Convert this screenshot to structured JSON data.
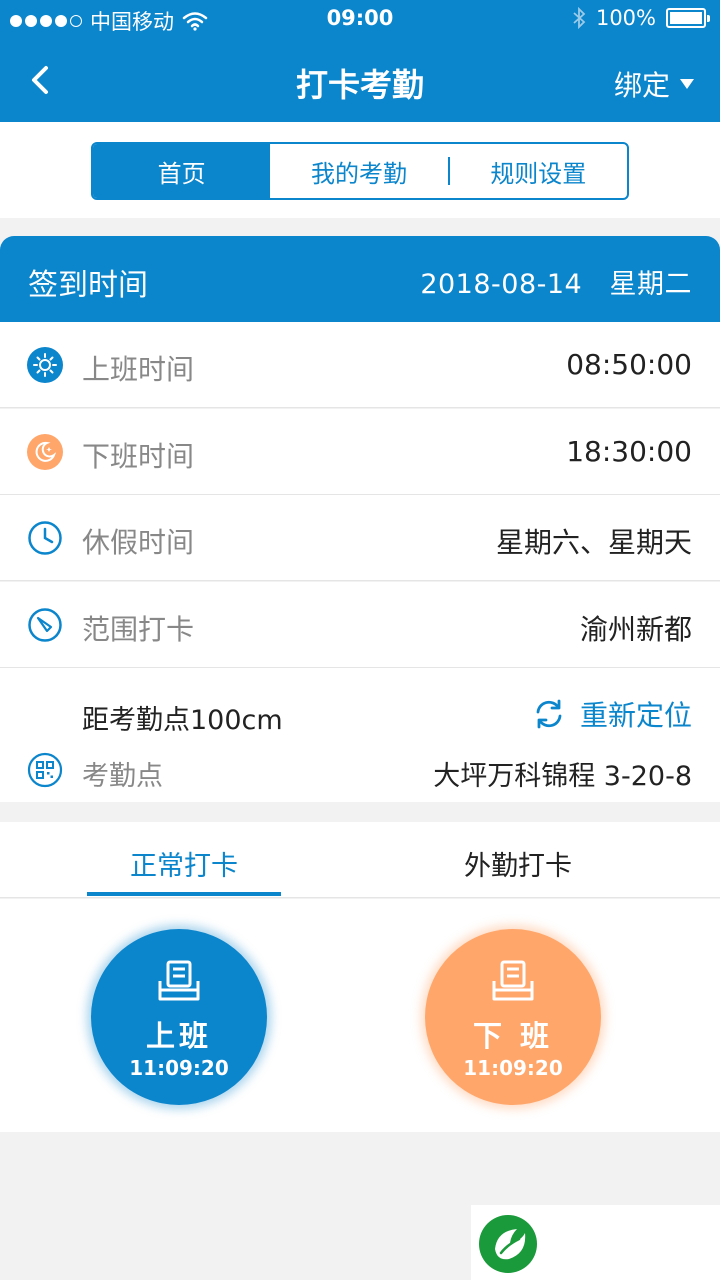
{
  "status_bar": {
    "carrier": "中国移动",
    "time": "09:00",
    "battery": "100%"
  },
  "nav": {
    "title": "打卡考勤",
    "bind_label": "绑定"
  },
  "segments": [
    {
      "label": "首页",
      "active": true
    },
    {
      "label": "我的考勤",
      "active": false
    },
    {
      "label": "规则设置",
      "active": false
    }
  ],
  "checkin": {
    "title": "签到时间",
    "date": "2018-08-14",
    "weekday": "星期二"
  },
  "rows": [
    {
      "icon": "sun-icon",
      "label": "上班时间",
      "value": "08:50:00"
    },
    {
      "icon": "moon-icon",
      "label": "下班时间",
      "value": "18:30:00"
    },
    {
      "icon": "clock-icon",
      "label": "休假时间",
      "value": "星期六、星期天"
    },
    {
      "icon": "compass-icon",
      "label": "范围打卡",
      "value": "渝州新都"
    }
  ],
  "location": {
    "distance": "距考勤点100cm",
    "relocate_label": "重新定位",
    "point_label": "考勤点",
    "point_value": "大坪万科锦程 3-20-8"
  },
  "tabs": [
    {
      "label": "正常打卡",
      "active": true
    },
    {
      "label": "外勤打卡",
      "active": false
    }
  ],
  "punch": {
    "on_duty_label": "上班",
    "on_duty_time": "11:09:20",
    "off_duty_label": "下 班",
    "off_duty_time": "11:09:20"
  },
  "colors": {
    "primary": "#0b85cc",
    "accent_orange": "#ffa66b",
    "logo_green": "#1a9a3a"
  }
}
